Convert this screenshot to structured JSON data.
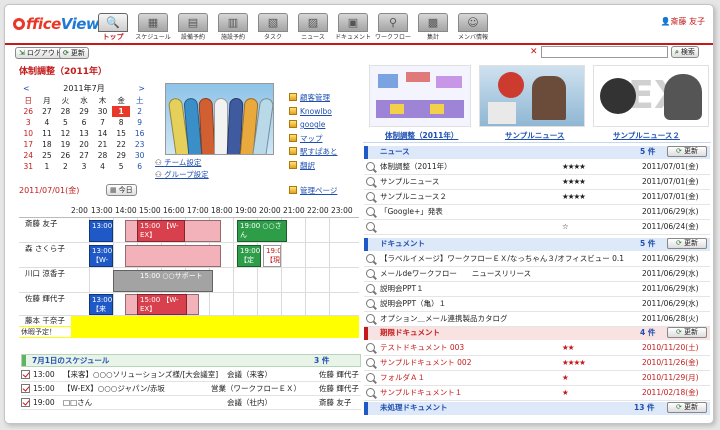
{
  "app": {
    "logo_prefix": "ffice",
    "logo_suffix": "View",
    "user": "斎藤 友子"
  },
  "nav": [
    {
      "label": "トップ",
      "icon": "search-icon",
      "glyph": "🔍"
    },
    {
      "label": "スケジュール",
      "icon": "calendar-icon",
      "glyph": "▦"
    },
    {
      "label": "設備予約",
      "icon": "facility-icon",
      "glyph": "▤"
    },
    {
      "label": "施設予約",
      "icon": "building-icon",
      "glyph": "▥"
    },
    {
      "label": "タスク",
      "icon": "task-icon",
      "glyph": "▧"
    },
    {
      "label": "ニュース",
      "icon": "news-icon",
      "glyph": "▨"
    },
    {
      "label": "ドキュメント",
      "icon": "document-icon",
      "glyph": "▣"
    },
    {
      "label": "ワークフロー",
      "icon": "workflow-icon",
      "glyph": "⚲"
    },
    {
      "label": "集計",
      "icon": "tally-icon",
      "glyph": "▩"
    },
    {
      "label": "メンバ情報",
      "icon": "members-icon",
      "glyph": "☺"
    }
  ],
  "toolbar": {
    "logout": "ログアウト",
    "refresh": "更新",
    "search_value": "",
    "search_button": "検索"
  },
  "page_title": "体制調整（2011年）",
  "calendar": {
    "prev": "<",
    "next": ">",
    "month": "2011年7月",
    "weekdays": [
      "日",
      "月",
      "火",
      "水",
      "木",
      "金",
      "土"
    ],
    "weeks": [
      [
        "26",
        "27",
        "28",
        "29",
        "30",
        "1",
        "2"
      ],
      [
        "3",
        "4",
        "5",
        "6",
        "7",
        "8",
        "9"
      ],
      [
        "10",
        "11",
        "12",
        "13",
        "14",
        "15",
        "16"
      ],
      [
        "17",
        "18",
        "19",
        "20",
        "21",
        "22",
        "23"
      ],
      [
        "24",
        "25",
        "26",
        "27",
        "28",
        "29",
        "30"
      ],
      [
        "31",
        "1",
        "2",
        "3",
        "4",
        "5",
        "6"
      ]
    ],
    "selected_date": "2011/07/01(金)",
    "today_button": "今日"
  },
  "groups": {
    "team": "チーム設定",
    "group": "グループ設定"
  },
  "links": [
    "顧客管理",
    "Knowlbo",
    "google",
    "マップ",
    "駅すぱあと",
    "翻訳"
  ],
  "admin_link": "管理ページ",
  "schedule": {
    "hours": [
      "2:00",
      "13:00",
      "14:00",
      "15:00",
      "16:00",
      "17:00",
      "18:00",
      "19:00",
      "20:00",
      "21:00",
      "22:00",
      "23:00"
    ],
    "rows": [
      {
        "name": "斎藤 友子",
        "events": [
          {
            "label": "13:00 【来",
            "color": "blue"
          },
          {
            "label": "15:00 【W-EX】",
            "color": "red"
          },
          {
            "label": "19:00 ○○さん",
            "color": "green"
          }
        ]
      },
      {
        "name": "森 さくら子",
        "events": [
          {
            "label": "13:00 【W-",
            "color": "blue"
          },
          {
            "label": "",
            "color": "pink"
          },
          {
            "label": "19:00 【定",
            "color": "green"
          },
          {
            "label": "19:00 【現",
            "color": "pink"
          }
        ]
      },
      {
        "name": "川口 涼香子",
        "events": [
          {
            "label": "15:00 ○○サポート",
            "color": "gray"
          }
        ]
      },
      {
        "name": "佐藤 輝代子",
        "events": [
          {
            "label": "13:00 【来",
            "color": "blue"
          },
          {
            "label": "15:00 【W-EX】",
            "color": "red"
          }
        ]
      },
      {
        "name": "藤本 千奈子",
        "events": []
      }
    ],
    "holiday_label": "休暇予定！"
  },
  "today_schedule": {
    "title": "7月1日のスケジュール",
    "count": "3 件",
    "items": [
      {
        "time": "13:00",
        "title": "【来客】○○○ソリューションズ様/[大会議室]",
        "type": "会議（来客）",
        "person": "佐藤 輝代子"
      },
      {
        "time": "15:00",
        "title": "【W-EX】○○○ジャパン/赤坂",
        "type": "営業（ワークフローＥＸ）",
        "person": "佐藤 輝代子"
      },
      {
        "time": "19:00",
        "title": "□□さん",
        "type": "会議（社内）",
        "person": "斎藤 友子"
      }
    ]
  },
  "banners": [
    {
      "label": "体制調整（2011年）"
    },
    {
      "label": "サンプルニュース"
    },
    {
      "label": "サンプルニュース２"
    }
  ],
  "news": {
    "title": "ニュース",
    "count": "5 件",
    "update": "更新",
    "items": [
      {
        "title": "体制調整（2011年）",
        "stars": "★★★★",
        "date": "2011/07/01(金)"
      },
      {
        "title": "サンプルニュース",
        "stars": "★★★★",
        "date": "2011/07/01(金)"
      },
      {
        "title": "サンプルニュース２",
        "stars": "★★★★",
        "date": "2011/07/01(金)"
      },
      {
        "title": "「Google+」発表",
        "stars": "",
        "date": "2011/06/29(水)"
      },
      {
        "title": "",
        "stars": "☆",
        "date": "2011/06/24(金)"
      }
    ]
  },
  "documents": {
    "title": "ドキュメント",
    "count": "5 件",
    "update": "更新",
    "items": [
      {
        "title": "【ラベルイメージ】ワークフローＥＸ/なっちゃん３/オフィスビュー 0.1",
        "date": "2011/06/29(水)"
      },
      {
        "title": "メールdeワークフロー　　ニュースリリース",
        "date": "2011/06/29(水)"
      },
      {
        "title": "説明会PPT１",
        "date": "2011/06/29(水)"
      },
      {
        "title": "説明会PPT（亀）１",
        "date": "2011/06/29(水)"
      },
      {
        "title": "オプション＿メール連携製品カタログ",
        "date": "2011/06/28(火)"
      }
    ]
  },
  "expiring": {
    "title": "期限ドキュメント",
    "count": "4 件",
    "update": "更新",
    "items": [
      {
        "title": "テストドキュメント 003",
        "stars": "★★",
        "date": "2010/11/20(土)"
      },
      {
        "title": "サンプルドキュメント 002",
        "stars": "★★★★",
        "date": "2010/11/26(金)"
      },
      {
        "title": "フォルダＡ１",
        "stars": "★",
        "date": "2010/11/29(月)"
      },
      {
        "title": "サンプルドキュメント１",
        "stars": "★",
        "date": "2011/02/18(金)"
      }
    ]
  },
  "unprocessed": {
    "title": "未処理ドキュメント",
    "count": "13 件",
    "update": "更新"
  },
  "colors": {
    "accent": "#c41a1a",
    "link": "#1f4fb0",
    "event_blue": "#1f59c8",
    "event_red": "#d8404d",
    "event_green": "#2d9d48",
    "holiday": "#ffff00"
  }
}
